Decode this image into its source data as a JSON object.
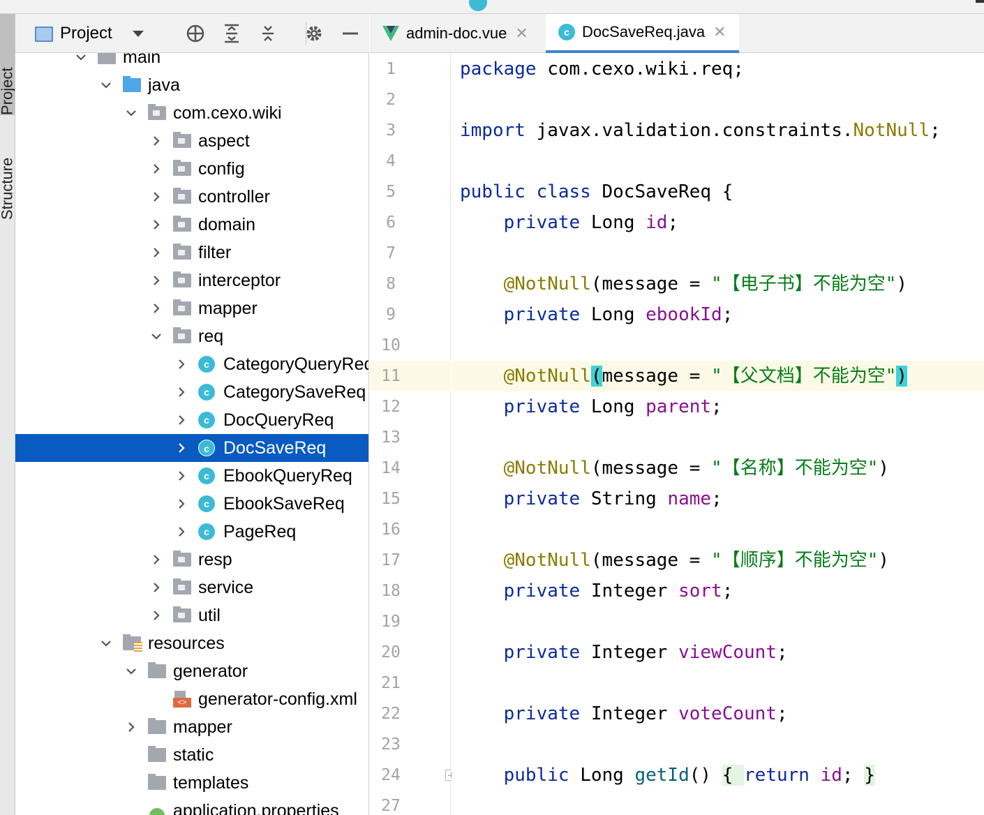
{
  "project_panel": {
    "title": "Project",
    "side_tabs": {
      "project": "Project",
      "structure": "Structure"
    },
    "tree": [
      {
        "label": "main",
        "type": "folder",
        "depth": 0,
        "expanded": true
      },
      {
        "label": "java",
        "type": "source-folder",
        "depth": 1,
        "expanded": true
      },
      {
        "label": "com.cexo.wiki",
        "type": "package",
        "depth": 2,
        "expanded": true
      },
      {
        "label": "aspect",
        "type": "package",
        "depth": 3,
        "expanded": false
      },
      {
        "label": "config",
        "type": "package",
        "depth": 3,
        "expanded": false
      },
      {
        "label": "controller",
        "type": "package",
        "depth": 3,
        "expanded": false
      },
      {
        "label": "domain",
        "type": "package",
        "depth": 3,
        "expanded": false
      },
      {
        "label": "filter",
        "type": "package",
        "depth": 3,
        "expanded": false
      },
      {
        "label": "interceptor",
        "type": "package",
        "depth": 3,
        "expanded": false
      },
      {
        "label": "mapper",
        "type": "package",
        "depth": 3,
        "expanded": false
      },
      {
        "label": "req",
        "type": "package",
        "depth": 3,
        "expanded": true
      },
      {
        "label": "CategoryQueryReq",
        "type": "class",
        "depth": 4,
        "expanded": false
      },
      {
        "label": "CategorySaveReq",
        "type": "class",
        "depth": 4,
        "expanded": false
      },
      {
        "label": "DocQueryReq",
        "type": "class",
        "depth": 4,
        "expanded": false
      },
      {
        "label": "DocSaveReq",
        "type": "class",
        "depth": 4,
        "expanded": false,
        "selected": true
      },
      {
        "label": "EbookQueryReq",
        "type": "class",
        "depth": 4,
        "expanded": false
      },
      {
        "label": "EbookSaveReq",
        "type": "class",
        "depth": 4,
        "expanded": false
      },
      {
        "label": "PageReq",
        "type": "class",
        "depth": 4,
        "expanded": false
      },
      {
        "label": "resp",
        "type": "package",
        "depth": 3,
        "expanded": false
      },
      {
        "label": "service",
        "type": "package",
        "depth": 3,
        "expanded": false
      },
      {
        "label": "util",
        "type": "package",
        "depth": 3,
        "expanded": false
      },
      {
        "label": "resources",
        "type": "resources-folder",
        "depth": 1,
        "expanded": true
      },
      {
        "label": "generator",
        "type": "folder",
        "depth": 2,
        "expanded": true
      },
      {
        "label": "generator-config.xml",
        "type": "xml",
        "depth": 3,
        "leaf": true
      },
      {
        "label": "mapper",
        "type": "folder",
        "depth": 2,
        "expanded": false
      },
      {
        "label": "static",
        "type": "folder",
        "depth": 2,
        "leaf": true
      },
      {
        "label": "templates",
        "type": "folder",
        "depth": 2,
        "leaf": true
      },
      {
        "label": "application.properties",
        "type": "properties",
        "depth": 2,
        "leaf": true
      }
    ]
  },
  "editor": {
    "tabs": [
      {
        "label": "admin-doc.vue",
        "icon": "vue-icon",
        "active": false
      },
      {
        "label": "DocSaveReq.java",
        "icon": "class-icon",
        "active": true
      }
    ],
    "current_line": 11,
    "lines": [
      {
        "n": "1",
        "tokens": [
          [
            "kw",
            "package"
          ],
          [
            "p",
            " com.cexo.wiki.req;"
          ]
        ]
      },
      {
        "n": "2",
        "tokens": []
      },
      {
        "n": "3",
        "tokens": [
          [
            "kw",
            "import"
          ],
          [
            "p",
            " javax.validation.constraints."
          ],
          [
            "ann",
            "NotNull"
          ],
          [
            "p",
            ";"
          ]
        ]
      },
      {
        "n": "4",
        "tokens": []
      },
      {
        "n": "5",
        "tokens": [
          [
            "kw",
            "public class"
          ],
          [
            "p",
            " DocSaveReq {"
          ]
        ]
      },
      {
        "n": "6",
        "tokens": [
          [
            "p",
            "    "
          ],
          [
            "kw",
            "private"
          ],
          [
            "p",
            " Long "
          ],
          [
            "fld",
            "id"
          ],
          [
            "p",
            ";"
          ]
        ]
      },
      {
        "n": "7",
        "tokens": []
      },
      {
        "n": "8",
        "tokens": [
          [
            "p",
            "    "
          ],
          [
            "ann",
            "@NotNull"
          ],
          [
            "p",
            "(message = "
          ],
          [
            "str",
            "\"【电子书】不能为空\""
          ],
          [
            "p",
            ")"
          ]
        ]
      },
      {
        "n": "9",
        "tokens": [
          [
            "p",
            "    "
          ],
          [
            "kw",
            "private"
          ],
          [
            "p",
            " Long "
          ],
          [
            "fld",
            "ebookId"
          ],
          [
            "p",
            ";"
          ]
        ]
      },
      {
        "n": "10",
        "tokens": []
      },
      {
        "n": "11",
        "tokens": [
          [
            "p",
            "    "
          ],
          [
            "ann",
            "@NotNull"
          ],
          [
            "brk",
            "("
          ],
          [
            "p",
            "message = "
          ],
          [
            "str",
            "\"【父文档】不能为空\""
          ],
          [
            "brk",
            ")"
          ]
        ]
      },
      {
        "n": "12",
        "tokens": [
          [
            "p",
            "    "
          ],
          [
            "kw",
            "private"
          ],
          [
            "p",
            " Long "
          ],
          [
            "fld",
            "parent"
          ],
          [
            "p",
            ";"
          ]
        ]
      },
      {
        "n": "13",
        "tokens": []
      },
      {
        "n": "14",
        "tokens": [
          [
            "p",
            "    "
          ],
          [
            "ann",
            "@NotNull"
          ],
          [
            "p",
            "(message = "
          ],
          [
            "str",
            "\"【名称】不能为空\""
          ],
          [
            "p",
            ")"
          ]
        ]
      },
      {
        "n": "15",
        "tokens": [
          [
            "p",
            "    "
          ],
          [
            "kw",
            "private"
          ],
          [
            "p",
            " String "
          ],
          [
            "fld",
            "name"
          ],
          [
            "p",
            ";"
          ]
        ]
      },
      {
        "n": "16",
        "tokens": []
      },
      {
        "n": "17",
        "tokens": [
          [
            "p",
            "    "
          ],
          [
            "ann",
            "@NotNull"
          ],
          [
            "p",
            "(message = "
          ],
          [
            "str",
            "\"【顺序】不能为空\""
          ],
          [
            "p",
            ")"
          ]
        ]
      },
      {
        "n": "18",
        "tokens": [
          [
            "p",
            "    "
          ],
          [
            "kw",
            "private"
          ],
          [
            "p",
            " Integer "
          ],
          [
            "fld",
            "sort"
          ],
          [
            "p",
            ";"
          ]
        ]
      },
      {
        "n": "19",
        "tokens": []
      },
      {
        "n": "20",
        "tokens": [
          [
            "p",
            "    "
          ],
          [
            "kw",
            "private"
          ],
          [
            "p",
            " Integer "
          ],
          [
            "fld",
            "viewCount"
          ],
          [
            "p",
            ";"
          ]
        ]
      },
      {
        "n": "21",
        "tokens": []
      },
      {
        "n": "22",
        "tokens": [
          [
            "p",
            "    "
          ],
          [
            "kw",
            "private"
          ],
          [
            "p",
            " Integer "
          ],
          [
            "fld",
            "voteCount"
          ],
          [
            "p",
            ";"
          ]
        ]
      },
      {
        "n": "23",
        "tokens": []
      },
      {
        "n": "24",
        "tokens": [
          [
            "p",
            "    "
          ],
          [
            "kw",
            "public"
          ],
          [
            "p",
            " Long "
          ],
          [
            "meth",
            "getId"
          ],
          [
            "p",
            "() "
          ],
          [
            "brc",
            "{ "
          ],
          [
            "kw",
            "return"
          ],
          [
            "p",
            " "
          ],
          [
            "fld",
            "id"
          ],
          [
            "p",
            "; "
          ],
          [
            "brc",
            "}"
          ]
        ]
      },
      {
        "n": "27",
        "tokens": []
      }
    ]
  },
  "colors": {
    "selection": "#0a5bc1",
    "keyword": "#0b2b9b",
    "annotation": "#8a7b00",
    "string": "#067d17",
    "field": "#871094",
    "current_line": "#fcfae7"
  }
}
